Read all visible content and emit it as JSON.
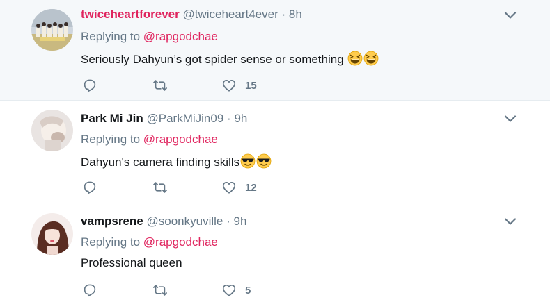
{
  "tweets": [
    {
      "name": "twiceheartforever",
      "handle": "@twiceheart4ever",
      "dot": "·",
      "time": "8h",
      "replying_prefix": "Replying to",
      "replying_to": "@rapgodchae",
      "text": "Seriously Dahyun’s got spider sense or something",
      "emojis": [
        "grinning-squinting-face",
        "grinning-squinting-face"
      ],
      "likes": "15"
    },
    {
      "name": "Park Mi Jin",
      "handle": "@ParkMiJin09",
      "dot": "·",
      "time": "9h",
      "replying_prefix": "Replying to",
      "replying_to": "@rapgodchae",
      "text": "Dahyun's camera finding skills",
      "emojis": [
        "smiling-face-with-sunglasses",
        "smiling-face-with-sunglasses"
      ],
      "likes": "12"
    },
    {
      "name": "vampsrene",
      "handle": "@soonkyuville",
      "dot": "·",
      "time": "9h",
      "replying_prefix": "Replying to",
      "replying_to": "@rapgodchae",
      "text": "Professional queen",
      "emojis": [],
      "likes": "5"
    }
  ],
  "colors": {
    "accent": "#e0245e",
    "secondary_text": "#657786",
    "highlight_bg": "#f5f8fa",
    "divider": "#e6ecf0"
  }
}
